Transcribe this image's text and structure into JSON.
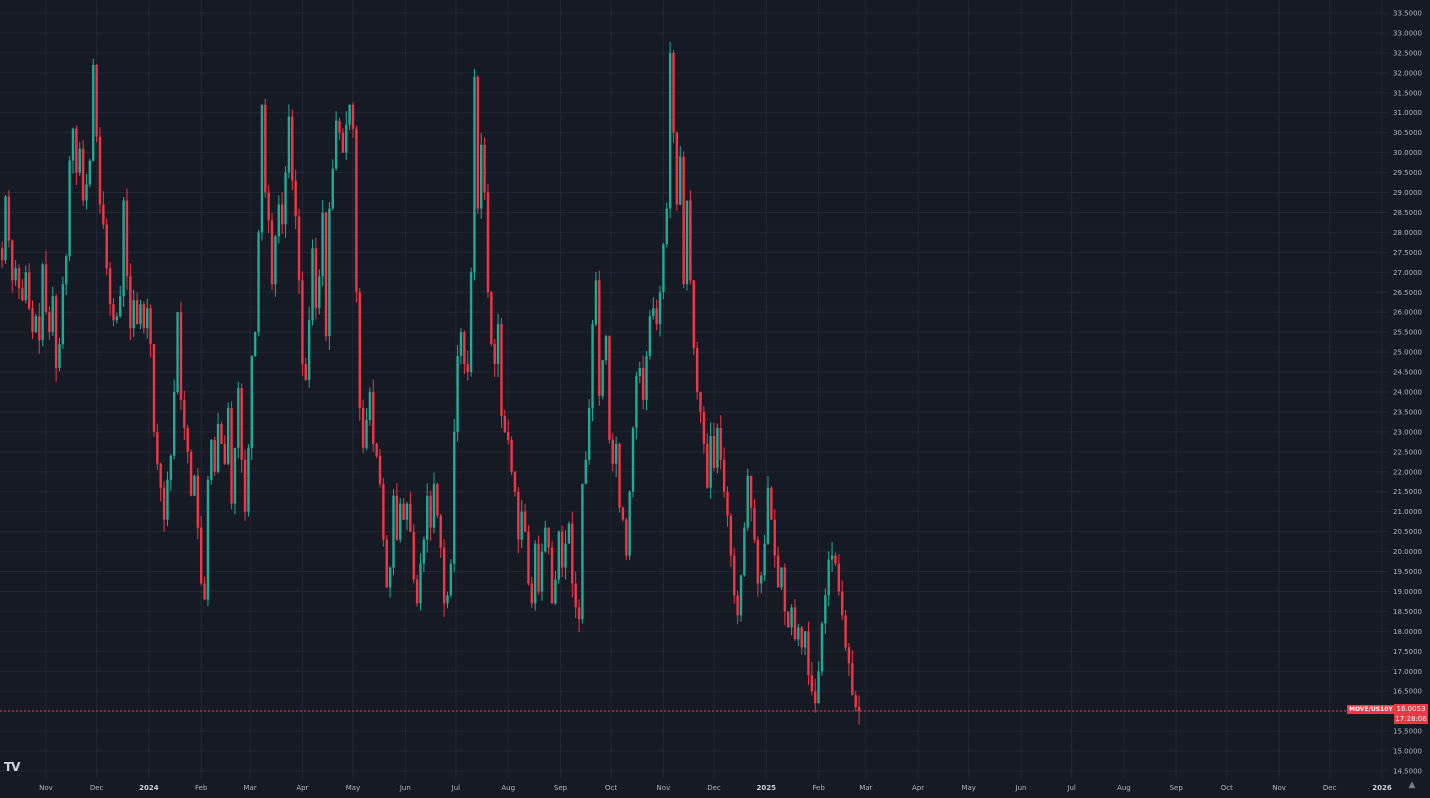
{
  "symbol": "MOVE/US10Y",
  "last_price": "16.0053",
  "countdown": "17:28:06",
  "logo_text": "TV",
  "colors": {
    "background": "#161a25",
    "grid": "#232733",
    "up": "#22ab94",
    "down": "#f23645",
    "axis_text": "#b2b5be"
  },
  "chart_data": {
    "type": "candlestick",
    "y_ticks": [
      14.5,
      15,
      15.5,
      16,
      16.5,
      17,
      17.5,
      18,
      18.5,
      19,
      19.5,
      20,
      20.5,
      21,
      21.5,
      22,
      22.5,
      23,
      23.5,
      24,
      24.5,
      25,
      25.5,
      26,
      26.5,
      27,
      27.5,
      28,
      28.5,
      29,
      29.5,
      30,
      30.5,
      31,
      31.5,
      32,
      32.5,
      33,
      33.5
    ],
    "y_tick_labels": [
      "14.5000",
      "15.0000",
      "15.5000",
      "16.0000",
      "16.5000",
      "17.0000",
      "17.5000",
      "18.0000",
      "18.5000",
      "19.0000",
      "19.5000",
      "20.0000",
      "20.5000",
      "21.0000",
      "21.5000",
      "22.0000",
      "22.5000",
      "23.0000",
      "23.5000",
      "24.0000",
      "24.5000",
      "25.0000",
      "25.5000",
      "26.0000",
      "26.5000",
      "27.0000",
      "27.5000",
      "28.0000",
      "28.5000",
      "29.0000",
      "29.5000",
      "30.0000",
      "30.5000",
      "31.0000",
      "31.5000",
      "32.0000",
      "32.5000",
      "33.0000",
      "33.5000"
    ],
    "ylim": [
      14.35,
      33.75
    ],
    "x_labels": [
      {
        "label": "Nov",
        "day": 0,
        "bold": false
      },
      {
        "label": "Dec",
        "day": 30,
        "bold": false
      },
      {
        "label": "2024",
        "day": 61,
        "bold": true
      },
      {
        "label": "Feb",
        "day": 92,
        "bold": false
      },
      {
        "label": "Mar",
        "day": 121,
        "bold": false
      },
      {
        "label": "Apr",
        "day": 152,
        "bold": false
      },
      {
        "label": "May",
        "day": 182,
        "bold": false
      },
      {
        "label": "Jun",
        "day": 213,
        "bold": false
      },
      {
        "label": "Jul",
        "day": 243,
        "bold": false
      },
      {
        "label": "Aug",
        "day": 274,
        "bold": false
      },
      {
        "label": "Sep",
        "day": 305,
        "bold": false
      },
      {
        "label": "Oct",
        "day": 335,
        "bold": false
      },
      {
        "label": "Nov",
        "day": 366,
        "bold": false
      },
      {
        "label": "Dec",
        "day": 396,
        "bold": false
      },
      {
        "label": "2025",
        "day": 427,
        "bold": true
      },
      {
        "label": "Feb",
        "day": 458,
        "bold": false
      },
      {
        "label": "Mar",
        "day": 486,
        "bold": false
      },
      {
        "label": "Apr",
        "day": 517,
        "bold": false
      },
      {
        "label": "May",
        "day": 547,
        "bold": false
      },
      {
        "label": "Jun",
        "day": 578,
        "bold": false
      },
      {
        "label": "Jul",
        "day": 608,
        "bold": false
      },
      {
        "label": "Aug",
        "day": 639,
        "bold": false
      },
      {
        "label": "Sep",
        "day": 670,
        "bold": false
      },
      {
        "label": "Oct",
        "day": 700,
        "bold": false
      },
      {
        "label": "Nov",
        "day": 731,
        "bold": false
      },
      {
        "label": "Dec",
        "day": 761,
        "bold": false
      },
      {
        "label": "2026",
        "day": 792,
        "bold": true
      }
    ],
    "last_value": 16.0053,
    "closes": [
      [
        -26,
        27.3
      ],
      [
        -24,
        28.9
      ],
      [
        -22,
        27.8
      ],
      [
        -20,
        26.8
      ],
      [
        -18,
        27.1
      ],
      [
        -16,
        26.6
      ],
      [
        -14,
        26.3
      ],
      [
        -12,
        27.0
      ],
      [
        -10,
        26.1
      ],
      [
        -8,
        25.5
      ],
      [
        -6,
        25.9
      ],
      [
        -4,
        25.3
      ],
      [
        -2,
        27.2
      ],
      [
        0,
        26.0
      ],
      [
        2,
        25.5
      ],
      [
        4,
        26.4
      ],
      [
        6,
        24.6
      ],
      [
        8,
        25.2
      ],
      [
        10,
        26.7
      ],
      [
        12,
        27.4
      ],
      [
        14,
        29.8
      ],
      [
        16,
        30.6
      ],
      [
        18,
        29.5
      ],
      [
        20,
        30.1
      ],
      [
        22,
        28.8
      ],
      [
        24,
        29.2
      ],
      [
        26,
        29.8
      ],
      [
        28,
        32.2
      ],
      [
        30,
        30.4
      ],
      [
        32,
        28.7
      ],
      [
        34,
        28.2
      ],
      [
        36,
        27.1
      ],
      [
        38,
        26.2
      ],
      [
        40,
        25.8
      ],
      [
        42,
        25.9
      ],
      [
        44,
        26.4
      ],
      [
        46,
        28.8
      ],
      [
        48,
        26.9
      ],
      [
        50,
        25.6
      ],
      [
        52,
        26.3
      ],
      [
        54,
        25.7
      ],
      [
        56,
        26.2
      ],
      [
        58,
        25.6
      ],
      [
        60,
        26.1
      ],
      [
        62,
        25.2
      ],
      [
        64,
        23.0
      ],
      [
        66,
        22.2
      ],
      [
        68,
        21.6
      ],
      [
        70,
        20.8
      ],
      [
        72,
        21.8
      ],
      [
        74,
        22.4
      ],
      [
        76,
        24.0
      ],
      [
        78,
        26.0
      ],
      [
        80,
        23.8
      ],
      [
        82,
        23.1
      ],
      [
        84,
        22.5
      ],
      [
        86,
        21.4
      ],
      [
        88,
        21.9
      ],
      [
        90,
        20.6
      ],
      [
        92,
        19.2
      ],
      [
        94,
        18.8
      ],
      [
        96,
        21.8
      ],
      [
        98,
        22.8
      ],
      [
        100,
        22.0
      ],
      [
        102,
        23.2
      ],
      [
        104,
        22.7
      ],
      [
        106,
        22.2
      ],
      [
        108,
        23.6
      ],
      [
        110,
        21.2
      ],
      [
        112,
        22.6
      ],
      [
        114,
        24.1
      ],
      [
        116,
        22.3
      ],
      [
        118,
        21.0
      ],
      [
        120,
        22.6
      ],
      [
        122,
        24.9
      ],
      [
        124,
        25.5
      ],
      [
        126,
        28.0
      ],
      [
        128,
        31.2
      ],
      [
        130,
        29.0
      ],
      [
        132,
        28.3
      ],
      [
        134,
        26.7
      ],
      [
        136,
        27.9
      ],
      [
        138,
        28.7
      ],
      [
        140,
        28.2
      ],
      [
        142,
        29.5
      ],
      [
        144,
        30.9
      ],
      [
        146,
        29.3
      ],
      [
        148,
        28.4
      ],
      [
        150,
        26.8
      ],
      [
        152,
        24.7
      ],
      [
        154,
        24.3
      ],
      [
        156,
        25.8
      ],
      [
        158,
        27.6
      ],
      [
        160,
        26.1
      ],
      [
        162,
        26.9
      ],
      [
        164,
        28.5
      ],
      [
        166,
        25.4
      ],
      [
        168,
        28.6
      ],
      [
        170,
        29.6
      ],
      [
        172,
        30.8
      ],
      [
        174,
        30.5
      ],
      [
        176,
        30.0
      ],
      [
        178,
        30.7
      ],
      [
        180,
        31.2
      ],
      [
        182,
        30.6
      ],
      [
        184,
        26.5
      ],
      [
        186,
        23.6
      ],
      [
        188,
        22.6
      ],
      [
        190,
        23.3
      ],
      [
        192,
        24.0
      ],
      [
        194,
        22.7
      ],
      [
        196,
        22.4
      ],
      [
        198,
        21.7
      ],
      [
        200,
        20.3
      ],
      [
        202,
        19.1
      ],
      [
        204,
        19.6
      ],
      [
        206,
        21.4
      ],
      [
        208,
        20.3
      ],
      [
        210,
        21.2
      ],
      [
        212,
        20.8
      ],
      [
        214,
        21.2
      ],
      [
        216,
        20.5
      ],
      [
        218,
        19.3
      ],
      [
        220,
        18.7
      ],
      [
        222,
        19.7
      ],
      [
        224,
        20.3
      ],
      [
        226,
        21.4
      ],
      [
        228,
        20.6
      ],
      [
        230,
        21.7
      ],
      [
        232,
        20.9
      ],
      [
        234,
        20.1
      ],
      [
        236,
        18.7
      ],
      [
        238,
        18.9
      ],
      [
        240,
        19.7
      ],
      [
        242,
        23.0
      ],
      [
        244,
        24.9
      ],
      [
        246,
        25.5
      ],
      [
        248,
        24.7
      ],
      [
        250,
        24.5
      ],
      [
        252,
        27.0
      ],
      [
        254,
        31.9
      ],
      [
        256,
        28.6
      ],
      [
        258,
        30.2
      ],
      [
        260,
        29.0
      ],
      [
        262,
        26.5
      ],
      [
        264,
        25.2
      ],
      [
        266,
        24.7
      ],
      [
        268,
        25.7
      ],
      [
        270,
        23.4
      ],
      [
        272,
        23.0
      ],
      [
        274,
        22.8
      ],
      [
        276,
        22.0
      ],
      [
        278,
        21.5
      ],
      [
        280,
        20.3
      ],
      [
        282,
        21.0
      ],
      [
        284,
        20.5
      ],
      [
        286,
        19.2
      ],
      [
        288,
        18.7
      ],
      [
        290,
        20.2
      ],
      [
        292,
        19.0
      ],
      [
        294,
        20.0
      ],
      [
        296,
        20.6
      ],
      [
        298,
        20.1
      ],
      [
        300,
        18.7
      ],
      [
        302,
        19.3
      ],
      [
        304,
        20.5
      ],
      [
        306,
        19.6
      ],
      [
        308,
        20.2
      ],
      [
        310,
        20.7
      ],
      [
        312,
        19.2
      ],
      [
        314,
        18.6
      ],
      [
        316,
        18.3
      ],
      [
        318,
        21.7
      ],
      [
        320,
        22.3
      ],
      [
        322,
        23.6
      ],
      [
        324,
        25.7
      ],
      [
        326,
        26.8
      ],
      [
        328,
        23.9
      ],
      [
        330,
        24.8
      ],
      [
        332,
        25.4
      ],
      [
        334,
        22.8
      ],
      [
        336,
        22.2
      ],
      [
        338,
        22.7
      ],
      [
        340,
        21.1
      ],
      [
        342,
        20.8
      ],
      [
        344,
        19.9
      ],
      [
        346,
        21.5
      ],
      [
        348,
        23.1
      ],
      [
        350,
        24.4
      ],
      [
        352,
        24.6
      ],
      [
        354,
        23.8
      ],
      [
        356,
        24.9
      ],
      [
        358,
        25.9
      ],
      [
        360,
        26.1
      ],
      [
        362,
        25.7
      ],
      [
        364,
        26.5
      ],
      [
        366,
        27.7
      ],
      [
        368,
        28.6
      ],
      [
        370,
        32.5
      ],
      [
        372,
        30.5
      ],
      [
        374,
        28.7
      ],
      [
        376,
        29.9
      ],
      [
        378,
        26.7
      ],
      [
        380,
        28.8
      ],
      [
        382,
        26.8
      ],
      [
        384,
        25.1
      ],
      [
        386,
        24.0
      ],
      [
        388,
        23.5
      ],
      [
        390,
        22.7
      ],
      [
        392,
        21.6
      ],
      [
        394,
        22.9
      ],
      [
        396,
        22.1
      ],
      [
        398,
        23.1
      ],
      [
        400,
        22.3
      ],
      [
        402,
        21.5
      ],
      [
        404,
        20.9
      ],
      [
        406,
        19.9
      ],
      [
        408,
        18.9
      ],
      [
        410,
        18.4
      ],
      [
        412,
        19.4
      ],
      [
        414,
        20.6
      ],
      [
        416,
        21.9
      ],
      [
        418,
        21.1
      ],
      [
        420,
        20.3
      ],
      [
        422,
        19.2
      ],
      [
        424,
        19.4
      ],
      [
        426,
        20.2
      ],
      [
        428,
        21.6
      ],
      [
        430,
        20.8
      ],
      [
        432,
        19.9
      ],
      [
        434,
        19.1
      ],
      [
        436,
        19.6
      ],
      [
        438,
        18.5
      ],
      [
        440,
        18.1
      ],
      [
        442,
        18.6
      ],
      [
        444,
        17.8
      ],
      [
        446,
        18.1
      ],
      [
        448,
        17.6
      ],
      [
        450,
        18.0
      ],
      [
        452,
        16.9
      ],
      [
        454,
        16.5
      ],
      [
        456,
        16.2
      ],
      [
        458,
        17.0
      ],
      [
        460,
        18.2
      ],
      [
        462,
        18.9
      ],
      [
        464,
        19.8
      ],
      [
        466,
        19.9
      ],
      [
        468,
        19.7
      ],
      [
        470,
        19.0
      ],
      [
        472,
        18.4
      ],
      [
        474,
        17.6
      ],
      [
        476,
        17.2
      ],
      [
        478,
        16.4
      ],
      [
        480,
        16.1
      ],
      [
        482,
        16.0053
      ]
    ]
  }
}
